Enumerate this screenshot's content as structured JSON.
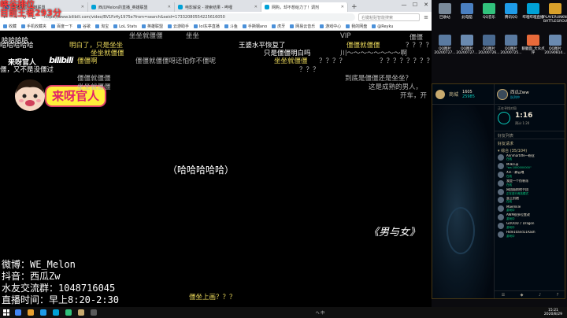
{
  "browser": {
    "tabs": [
      {
        "label": "直播排位_英雄联盟",
        "color": "#4a90d9",
        "active": false
      },
      {
        "label": "西瓜Melon的直播_英雄联盟",
        "color": "#00a1d6",
        "active": false
      },
      {
        "label": "电影解说 - 搜索结果 - 哔哩",
        "color": "#00a1d6",
        "active": false
      },
      {
        "label": "网购，却不想给力了！调剂",
        "color": "#00a1d6",
        "active": true
      }
    ],
    "url": "https://www.bilibili.com/video/BV1Pz4y1975e?from=search&seid=17332080554225616050",
    "search_placeholder": "右键粘贴智能搜索",
    "bookmarks": [
      "收藏",
      "手机收藏夹",
      "百度一下",
      "谷歌",
      "淘宝",
      "LoL Stats",
      "英雄联盟",
      "云游助手",
      "lol东亭直播",
      "斗鱼",
      "手撕钢ano",
      "虎牙",
      "网易云音乐",
      "游戏中心",
      "我的网盘",
      "@Reyku"
    ]
  },
  "video": {
    "rank_line1": "峡谷排位",
    "rank_line2": "目前王者293分",
    "host_name": "来呀官人",
    "bilibili_logo": "bilibili",
    "sticker_text": "来呀官人",
    "center_text": "（哈哈哈哈哈）",
    "song_title": "《男与女》",
    "info": {
      "weibo": "微博：WE_Melon",
      "douyin": "抖音：西瓜Zw",
      "fans_group": "水友交流群：1048716045",
      "live_time": "直播时间：早上8:20-2:30"
    },
    "danmaku": [
      {
        "text": "哈哈哈哈",
        "color": "w",
        "cls": "d1"
      },
      {
        "text": "坐坐就僵僵",
        "color": "g",
        "cls": "d2"
      },
      {
        "text": "坐坐",
        "color": "g",
        "cls": "d3"
      },
      {
        "text": "VIP",
        "color": "g",
        "cls": "d4"
      },
      {
        "text": "僵僵",
        "color": "g",
        "cls": "d5"
      },
      {
        "text": "哈哈哈哈哈",
        "color": "w",
        "cls": "d6"
      },
      {
        "text": "明白了，只是坐坐",
        "color": "y",
        "cls": "d7"
      },
      {
        "text": "王婆水平恢复了",
        "color": "w",
        "cls": "d8"
      },
      {
        "text": "僵僵就僵僵",
        "color": "y",
        "cls": "d9"
      },
      {
        "text": "？？？？",
        "color": "g",
        "cls": "d10"
      },
      {
        "text": "坐坐就僵僵",
        "color": "y",
        "cls": "d11"
      },
      {
        "text": "只是僵僵明白吗",
        "color": "w",
        "cls": "d12"
      },
      {
        "text": "川～～～～～～～～啊",
        "color": "g",
        "cls": "d13"
      },
      {
        "text": "僵僵啊",
        "color": "y",
        "cls": "d14"
      },
      {
        "text": "僵僵就僵僵呀还怕你不僵呢",
        "color": "g",
        "cls": "d15"
      },
      {
        "text": "坐坐就僵僵",
        "color": "y",
        "cls": "d16"
      },
      {
        "text": "？？？？",
        "color": "g",
        "cls": "d17"
      },
      {
        "text": "？？？？？？？？",
        "color": "g",
        "cls": "d18"
      },
      {
        "text": "僵，又不是没僵过",
        "color": "w",
        "cls": "d19"
      },
      {
        "text": "？？？",
        "color": "g",
        "cls": "d20"
      },
      {
        "text": "僵僵就僵僵",
        "color": "g",
        "cls": "d21"
      },
      {
        "text": "到底是僵僵还是坐坐？",
        "color": "g",
        "cls": "d22"
      },
      {
        "text": "坐坐就僵僵",
        "color": "g",
        "cls": "d23"
      },
      {
        "text": "这是成熟的男人，",
        "color": "g",
        "cls": "d24"
      },
      {
        "text": "开车，开",
        "color": "g",
        "cls": "d25"
      },
      {
        "text": "僵坐上画？？？",
        "color": "y",
        "cls": "d26"
      }
    ]
  },
  "desktop": {
    "icons": [
      {
        "label": "回收站",
        "color": "#7a8a9a"
      },
      {
        "label": "此电脑",
        "color": "#4a7fc0"
      },
      {
        "label": "QQ音乐",
        "color": "#31c27c"
      },
      {
        "label": "腾讯QQ",
        "color": "#1e9be8"
      },
      {
        "label": "哔哩哔哩直播",
        "color": "#00a1d6"
      },
      {
        "label": "PLAYERUNKNOWN'S BATTLEGROUNDS",
        "color": "#d8a02a"
      },
      {
        "label": "新建文本文档",
        "color": "#e8e8e8"
      },
      {
        "label": "新建文本文档(3)",
        "color": "#e8e8e8"
      },
      {
        "label": "新建文本文档(4)",
        "color": "#e8e8e8"
      },
      {
        "label": "QQ图片20200727...",
        "color": "#5a7aa0"
      },
      {
        "label": "QQ图片20200727...",
        "color": "#6a8ab0"
      },
      {
        "label": "QQ图片20200726...",
        "color": "#4a6a90"
      },
      {
        "label": "QQ图片20200725...",
        "color": "#5a7aa0"
      },
      {
        "label": "鹅腿面_大众点评",
        "color": "#e86a3a"
      },
      {
        "label": "QQ图片20190814...",
        "color": "#6a8ab0"
      }
    ]
  },
  "lol": {
    "nav_home": "主页",
    "nav_tft": "云顶之弈",
    "nav_shop": "商城",
    "rp": "1605",
    "be": "25985",
    "profile_name": "西瓜Zww",
    "profile_status": "队列中",
    "queue_label": "正在寻找对局",
    "queue_timer": "1:16",
    "queue_sub": "预计:1:20",
    "social_title": "好友列表",
    "friend_requests": "好友请求",
    "group_label": "▾ 综合 (35/104)",
    "friends": [
      {
        "name": "Annmartiffe一粉丝",
        "status": "在线"
      },
      {
        "name": "Milkcup",
        "status": "\"wa 1000000000\""
      },
      {
        "name": "Xin - 静云魂",
        "status": "在线"
      },
      {
        "name": "我是一个伪装派",
        "status": "在线"
      },
      {
        "name": "网团面前他手团",
        "status": "正在进行竞技模式"
      },
      {
        "name": "蛮王别跑",
        "status": "在线"
      },
      {
        "name": "Maemkle",
        "status": "游戏中"
      },
      {
        "name": "AWM很多位置改",
        "status": "游戏中"
      },
      {
        "name": "GOOOD ♪ Dragon",
        "status": "游戏中"
      },
      {
        "name": "Hide10and11Rash",
        "status": "游戏中"
      }
    ]
  },
  "taskbar": {
    "apps": [
      "#4285f4",
      "#e8a030",
      "#1e9be8",
      "#00a1d6",
      "#31c27c",
      "#c8aa6e",
      "#5a5a5a"
    ],
    "tray": "へ 中",
    "time": "15:21",
    "date": "2020/8/29"
  }
}
